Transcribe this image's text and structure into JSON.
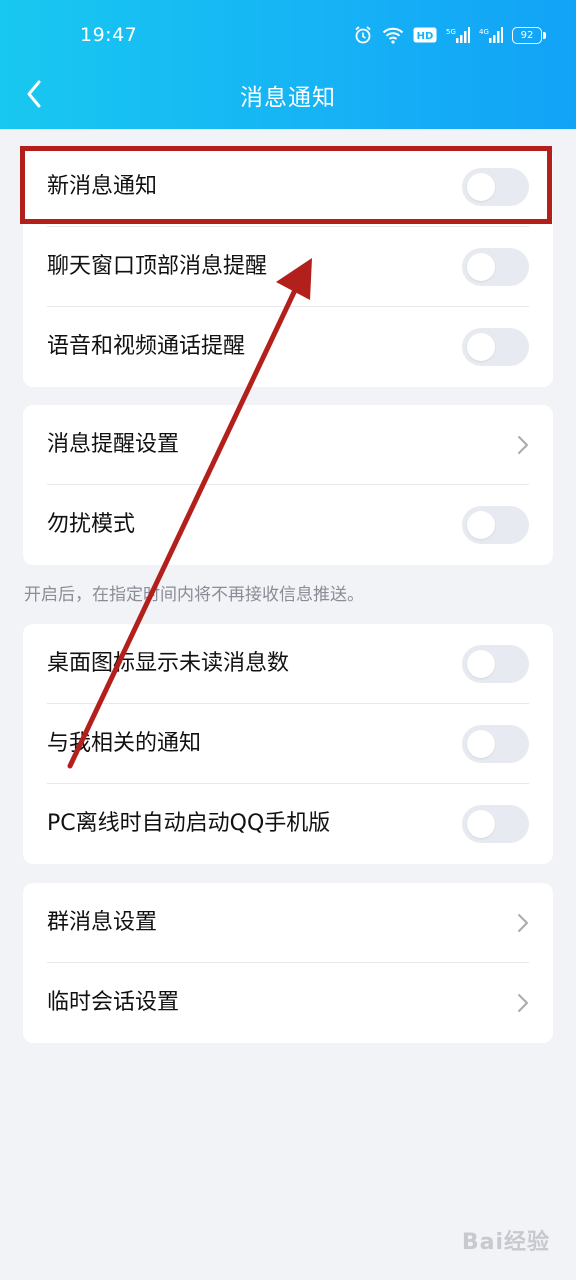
{
  "status_bar": {
    "time": "19:47",
    "battery": "92"
  },
  "header": {
    "title": "消息通知"
  },
  "section1": {
    "rows": [
      {
        "label": "新消息通知",
        "toggle_on": false
      },
      {
        "label": "聊天窗口顶部消息提醒",
        "toggle_on": false
      },
      {
        "label": "语音和视频通话提醒",
        "toggle_on": false
      }
    ]
  },
  "section2": {
    "rows": [
      {
        "label": "消息提醒设置"
      },
      {
        "label": "勿扰模式",
        "toggle_on": false
      }
    ],
    "note": "开启后，在指定时间内将不再接收信息推送。"
  },
  "section3": {
    "rows": [
      {
        "label": "桌面图标显示未读消息数",
        "toggle_on": false
      },
      {
        "label": "与我相关的通知",
        "toggle_on": false
      },
      {
        "label": "PC离线时自动启动QQ手机版",
        "toggle_on": false
      }
    ]
  },
  "section4": {
    "rows": [
      {
        "label": "群消息设置"
      },
      {
        "label": "临时会话设置"
      }
    ]
  },
  "watermark": "Bai经验",
  "colors": {
    "header_gradient_start": "#18c8f0",
    "header_gradient_end": "#12a3f7",
    "annotation_red": "#b3201c",
    "toggle_off": "#e7eaf0"
  }
}
